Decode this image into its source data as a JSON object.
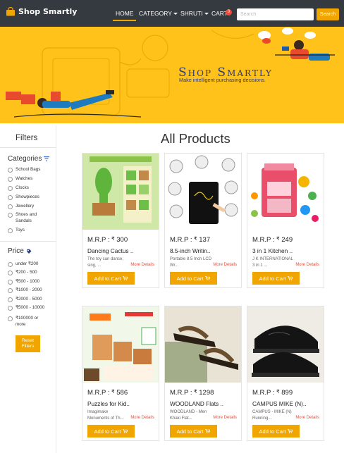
{
  "navbar": {
    "brand": "Shop Smartly",
    "home": "HOME",
    "category": "CATEGORY",
    "user": "SHRUTI",
    "cart": "CART",
    "cart_count": "0",
    "search_placeholder": "Search",
    "search_button": "Search"
  },
  "hero": {
    "title": "Shop Smartly",
    "tagline": "Make intelligent purchasing decisions."
  },
  "sidebar": {
    "title": "Filters",
    "categories_title": "Categories",
    "categories": [
      "School Bags",
      "Watches",
      "Clocks",
      "Showpieces",
      "Jewellery",
      "Shoes and Sandals",
      "Toys"
    ],
    "price_title": "Price",
    "prices": [
      "under ₹200",
      "₹200 - 500",
      "₹500 - 1000",
      "₹1000 - 2000",
      "₹2000 - 5000",
      "₹5000 - 10000",
      "₹100000 or more"
    ],
    "reset_label": "Reset Filters"
  },
  "main": {
    "heading": "All Products",
    "mrp_label": "M.R.P :",
    "currency": "₹",
    "more_details": "More Details",
    "add_to_cart": "Add to Cart",
    "products": [
      {
        "price": "300",
        "name": "Dancing Cactus ..",
        "desc": "The toy can dance, sing, ..."
      },
      {
        "price": "137",
        "name": "8.5-inch Writin..",
        "desc": "Portable 8.5 Inch LCD Wr..."
      },
      {
        "price": "249",
        "name": "3 in 1 Kitchen ..",
        "desc": "J K INTERNATIONAL 3 in 1 ..."
      },
      {
        "price": "586",
        "name": "Puzzles for Kid..",
        "desc": "Imagimake Monuments of Th..."
      },
      {
        "price": "1298",
        "name": "WOODLAND Flats ..",
        "desc": "WOODLAND - Men Khaki Flat..."
      },
      {
        "price": "899",
        "name": "CAMPUS MIKE (N)..",
        "desc": "CAMPUS - MIKE (N) Running..."
      }
    ]
  },
  "colors": {
    "navbar": "#343a40",
    "accent": "#f0a500",
    "hero": "#ffc21a",
    "hero_text": "#273a8a",
    "more_details": "#e74c3c"
  }
}
